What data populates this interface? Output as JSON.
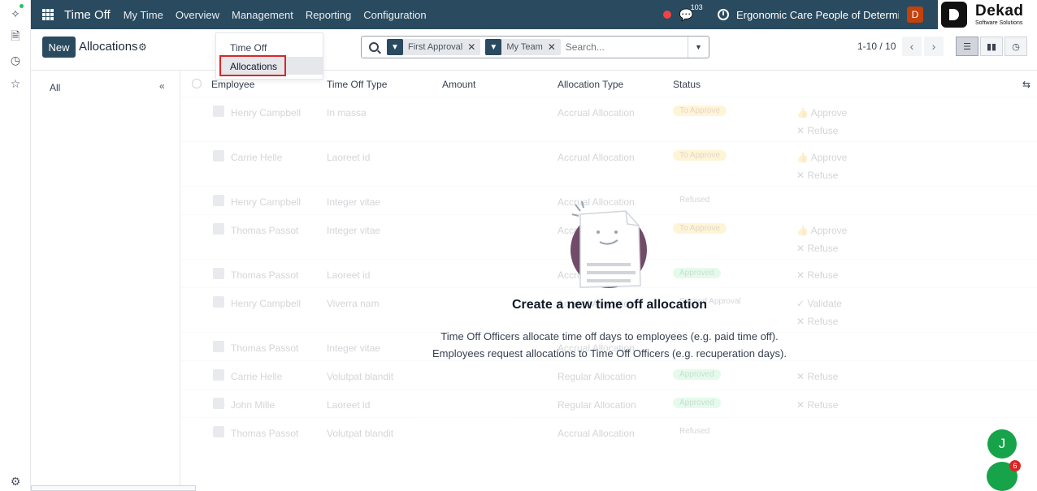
{
  "navbar": {
    "app_name": "Time Off",
    "menu": [
      "My Time",
      "Overview",
      "Management",
      "Reporting",
      "Configuration"
    ],
    "chat_count": "103",
    "company": "Ergonomic Care People of Determina...",
    "user_initial": "D"
  },
  "logo": {
    "name": "Dekad",
    "tagline": "Software Solutions"
  },
  "control": {
    "new_label": "New",
    "title": "Allocations",
    "search_placeholder": "Search...",
    "facets": [
      "First Approval",
      "My Team"
    ],
    "pager": "1-10 / 10"
  },
  "dropdown": {
    "items": [
      "Time Off",
      "Allocations"
    ],
    "active": "Allocations"
  },
  "sidebar": {
    "all_label": "All",
    "collapse_label": "«"
  },
  "table": {
    "columns": [
      "Employee",
      "Time Off Type",
      "Amount",
      "Allocation Type",
      "Status"
    ],
    "rows": [
      {
        "employee": "Henry Campbell",
        "type": "In massa",
        "alloc": "Accrual Allocation",
        "status": "To Approve",
        "status_kind": "warn",
        "actions": [
          "Approve",
          "Refuse"
        ]
      },
      {
        "employee": "Carrie Helle",
        "type": "Laoreet id",
        "alloc": "Accrual Allocation",
        "status": "To Approve",
        "status_kind": "warn",
        "actions": [
          "Approve",
          "Refuse"
        ]
      },
      {
        "employee": "Henry Campbell",
        "type": "Integer vitae",
        "alloc": "Accrual Allocation",
        "status": "Refused",
        "status_kind": "plain",
        "actions": []
      },
      {
        "employee": "Thomas Passot",
        "type": "Integer vitae",
        "alloc": "Accrual Allocation",
        "status": "To Approve",
        "status_kind": "warn",
        "actions": [
          "Approve",
          "Refuse"
        ]
      },
      {
        "employee": "Thomas Passot",
        "type": "Laoreet id",
        "alloc": "Accrual Allocation",
        "status": "Approved",
        "status_kind": "ok",
        "actions": [
          "Refuse"
        ]
      },
      {
        "employee": "Henry Campbell",
        "type": "Viverra nam",
        "alloc": "Accrual Allocation",
        "status": "Second Approval",
        "status_kind": "plain",
        "actions": [
          "Validate",
          "Refuse"
        ]
      },
      {
        "employee": "Thomas Passot",
        "type": "Integer vitae",
        "alloc": "Accrual Allocation",
        "status": "",
        "status_kind": "plain",
        "actions": []
      },
      {
        "employee": "Carrie Helle",
        "type": "Volutpat blandit",
        "alloc": "Regular Allocation",
        "status": "Approved",
        "status_kind": "ok",
        "actions": [
          "Refuse"
        ]
      },
      {
        "employee": "John Mille",
        "type": "Laoreet id",
        "alloc": "Regular Allocation",
        "status": "Approved",
        "status_kind": "ok",
        "actions": [
          "Refuse"
        ]
      },
      {
        "employee": "Thomas Passot",
        "type": "Volutpat blandit",
        "alloc": "Accrual Allocation",
        "status": "Refused",
        "status_kind": "plain",
        "actions": []
      }
    ]
  },
  "empty_state": {
    "title": "Create a new time off allocation",
    "line1": "Time Off Officers allocate time off days to employees (e.g. paid time off).",
    "line2": "Employees request allocations to Time Off Officers (e.g. recuperation days)."
  },
  "floating": {
    "user_initial": "J",
    "bot_badge": "6"
  },
  "colors": {
    "navbar": "#2a4a5f",
    "highlight": "#dc2626",
    "fab": "#16a34a",
    "illustration": "#714B67"
  }
}
